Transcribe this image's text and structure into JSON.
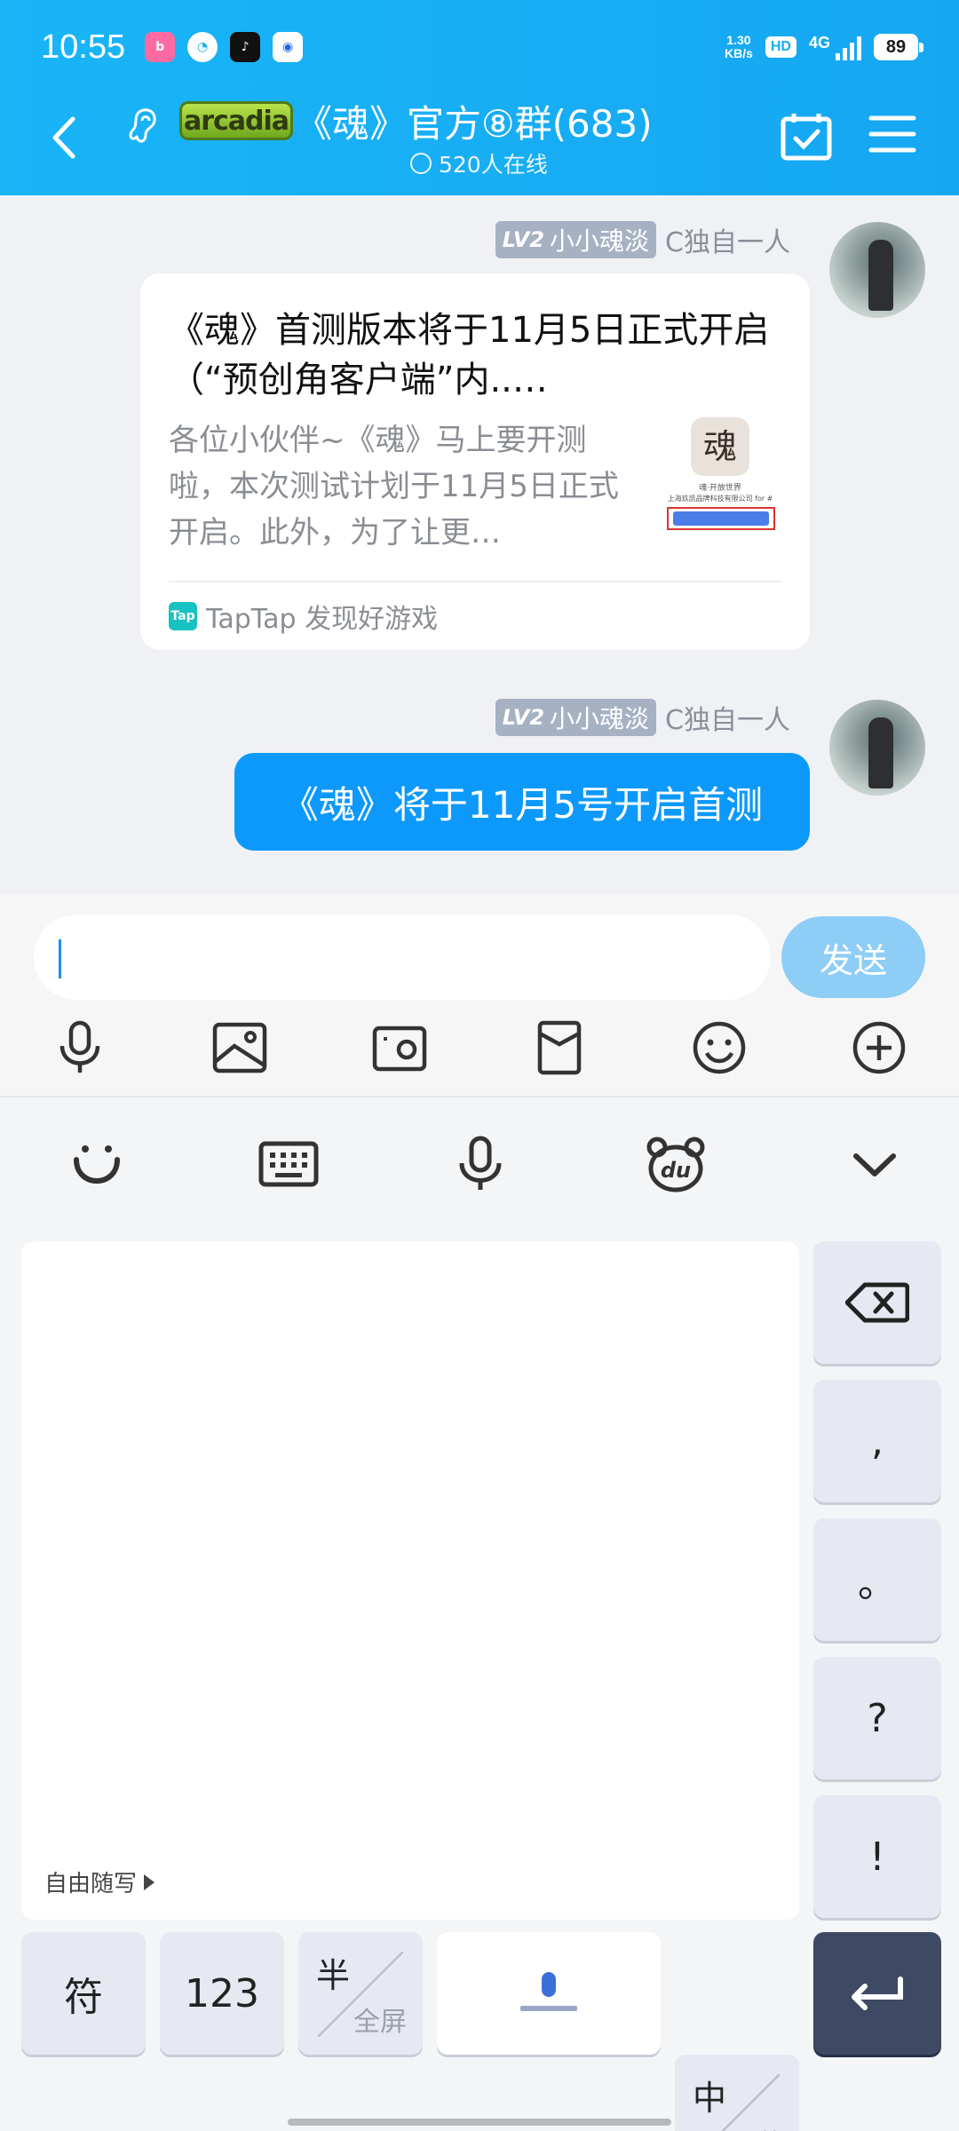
{
  "status_bar": {
    "time": "10:55",
    "net_speed_value": "1.30",
    "net_speed_unit": "KB/s",
    "hd": "HD",
    "network": "4G",
    "battery": "89"
  },
  "header": {
    "group_badge": "arcadia",
    "title": "《魂》官方⑧群(683)",
    "online": "520人在线"
  },
  "messages": [
    {
      "level": "LV2",
      "nickname": "小小魂淡",
      "sender": "C独自一人",
      "type": "link_card",
      "card_title": "《魂》首测版本将于11月5日正式开启（“预创角客户端”内..…",
      "card_desc": "各位小伙伴~《魂》马上要开测啦，本次测试计划于11月5日正式开启。此外，为了让更…",
      "card_thumb_title": "魂·开放世界",
      "card_thumb_company": "上海玖凯品牌科技有限公司 for #",
      "card_source": "TapTap 发现好游戏",
      "source_icon_text": "Tap"
    },
    {
      "level": "LV2",
      "nickname": "小小魂淡",
      "sender": "C独自一人",
      "type": "text",
      "text": "《魂》将于11月5号开启首测"
    }
  ],
  "input": {
    "value": "",
    "send_label": "发送"
  },
  "toolbar_icons": [
    "microphone-icon",
    "image-icon",
    "camera-icon",
    "red-packet-icon",
    "emoji-icon",
    "plus-icon"
  ],
  "keyboard": {
    "handwriting_label": "自由随写",
    "side_keys": [
      ",",
      "。",
      "?",
      "!"
    ],
    "bottom_keys": {
      "symbol": "符",
      "numbers": "123",
      "half_top": "半",
      "half_bottom": "全屏",
      "lang_top": "中",
      "lang_bottom": "英"
    }
  },
  "colors": {
    "header": "#16a7f2",
    "bubble": "#0d99fb",
    "send_disabled": "#8ecdf5",
    "enter_key": "#3e4a63"
  }
}
